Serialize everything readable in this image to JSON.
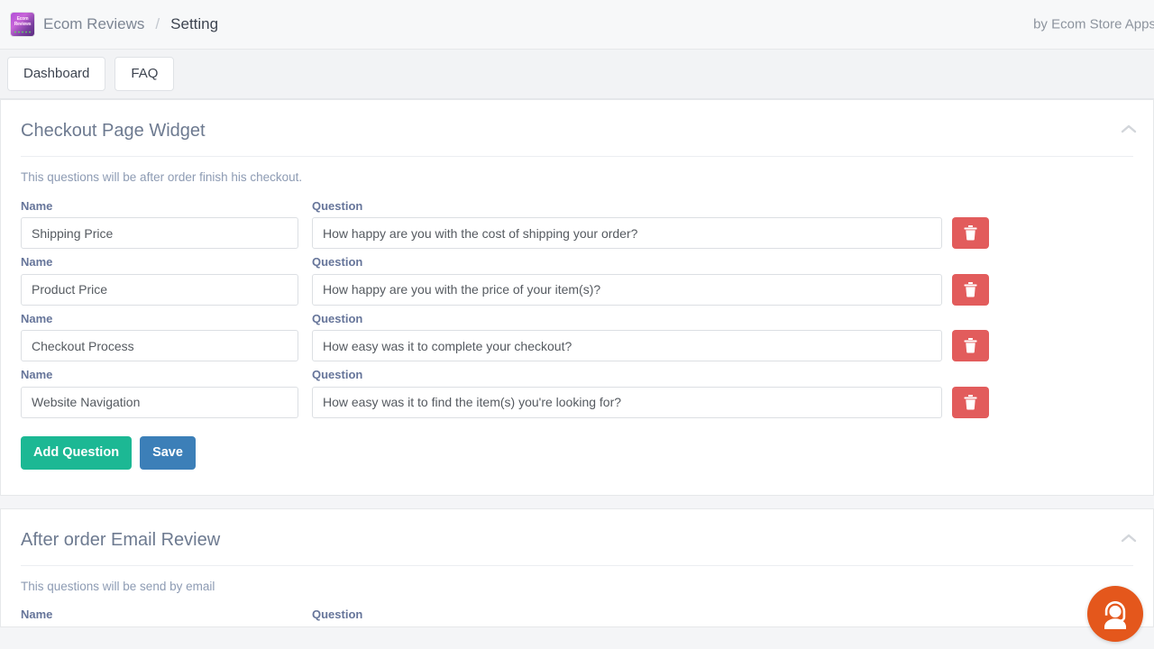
{
  "header": {
    "logo_icon": "ecom-reviews-app-logo",
    "logo_line1": "Ecom",
    "logo_line2": "Reviews",
    "brand_name": "Ecom Reviews",
    "separator": "/",
    "page_name": "Setting",
    "vendor": "by Ecom Store Apps"
  },
  "tabs": [
    {
      "label": "Dashboard",
      "name": "tab-dashboard"
    },
    {
      "label": "FAQ",
      "name": "tab-faq"
    }
  ],
  "cards": [
    {
      "title": "Checkout Page Widget",
      "description": "This questions will be after order finish his checkout.",
      "collapse_icon": "chevron-up-icon",
      "name_label": "Name",
      "question_label": "Question",
      "rows": [
        {
          "name": "Shipping Price",
          "question": "How happy are you with the cost of shipping your order?"
        },
        {
          "name": "Product Price",
          "question": "How happy are you with the price of your item(s)?"
        },
        {
          "name": "Checkout Process",
          "question": "How easy was it to complete your checkout?"
        },
        {
          "name": "Website Navigation",
          "question": "How easy was it to find the item(s) you're looking for?"
        }
      ],
      "delete_icon": "trash-icon",
      "add_label": "Add Question",
      "save_label": "Save"
    },
    {
      "title": "After order Email Review",
      "description": "This questions will be send by email",
      "collapse_icon": "chevron-up-icon",
      "name_label": "Name",
      "question_label": "Question"
    }
  ],
  "support": {
    "icon": "support-agent-icon"
  },
  "colors": {
    "accent_green": "#1cb894",
    "accent_blue": "#3c7fb8",
    "danger_red": "#e25c5c",
    "support_orange": "#e4571c",
    "title_gray": "#6d7a90",
    "label_blue": "#66759a"
  }
}
